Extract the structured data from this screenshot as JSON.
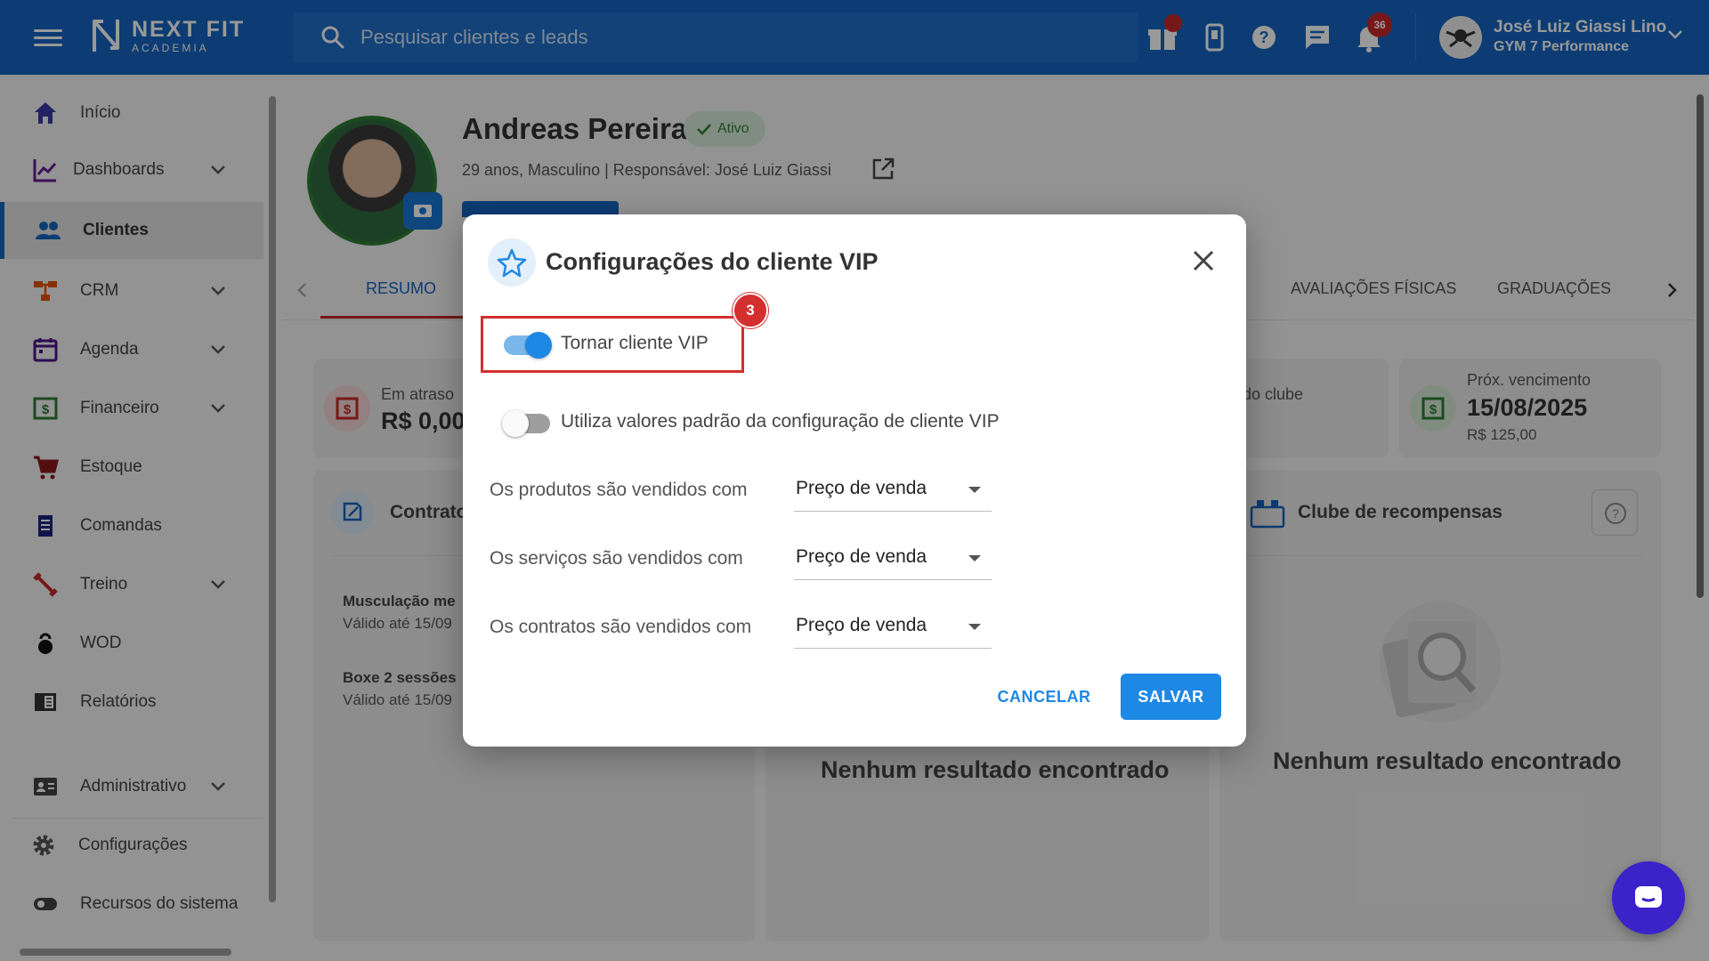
{
  "topbar": {
    "logo_line1": "NEXT FIT",
    "logo_line2": "ACADEMIA",
    "search_placeholder": "Pesquisar clientes e leads",
    "notifications_count": "36",
    "user_name": "José Luiz Giassi Lino",
    "user_org": "GYM 7 Performance"
  },
  "sidebar": {
    "items": [
      {
        "label": "Início",
        "icon": "home-icon"
      },
      {
        "label": "Dashboards",
        "icon": "chart-line-icon"
      },
      {
        "label": "Clientes",
        "icon": "people-icon"
      },
      {
        "label": "CRM",
        "icon": "flow-icon"
      },
      {
        "label": "Agenda",
        "icon": "calendar-icon"
      },
      {
        "label": "Financeiro",
        "icon": "money-icon"
      },
      {
        "label": "Estoque",
        "icon": "cart-icon"
      },
      {
        "label": "Comandas",
        "icon": "receipt-icon"
      },
      {
        "label": "Treino",
        "icon": "dumbbell-icon"
      },
      {
        "label": "WOD",
        "icon": "kettlebell-icon"
      },
      {
        "label": "Relatórios",
        "icon": "report-icon"
      },
      {
        "label": "Administrativo",
        "icon": "id-card-icon"
      },
      {
        "label": "Configurações",
        "icon": "gear-icon"
      },
      {
        "label": "Recursos do sistema",
        "icon": "toggle-icon"
      }
    ]
  },
  "profile": {
    "name": "Andreas Pereira",
    "status": "Ativo",
    "subtitle": "29 anos, Masculino | Responsável: José Luiz Giassi"
  },
  "tabs": [
    "RESUMO",
    "AVALIAÇÕES FÍSICAS",
    "GRADUAÇÕES"
  ],
  "cards": {
    "overdue_label": "Em atraso",
    "overdue_value": "R$ 0,00",
    "club_partial": "do clube",
    "next_due_label": "Próx. vencimento",
    "next_due_date": "15/08/2025",
    "next_due_amount": "R$ 125,00",
    "contracts_title": "Contrato",
    "contract1_name": "Musculação me",
    "contract1_valid": "Válido até 15/09",
    "contract2_name": "Boxe 2 sessões",
    "contract2_valid": "Válido até 15/09",
    "rewards_title": "Clube de recompensas",
    "empty_mid": "Nenhum resultado encontrado",
    "empty_right": "Nenhum resultado encontrado"
  },
  "modal": {
    "title": "Configurações do cliente VIP",
    "step_number": "3",
    "vip_toggle_label": "Tornar cliente VIP",
    "vip_toggle_on": true,
    "default_toggle_label": "Utiliza valores padrão da configuração de cliente VIP",
    "default_toggle_on": false,
    "rows": [
      {
        "label": "Os produtos são vendidos com",
        "value": "Preço de venda"
      },
      {
        "label": "Os serviços são vendidos com",
        "value": "Preço de venda"
      },
      {
        "label": "Os contratos são vendidos com",
        "value": "Preço de venda"
      }
    ],
    "cancel_label": "CANCELAR",
    "save_label": "SALVAR"
  },
  "colors": {
    "primary": "#1565c0",
    "accent": "#1e88e5",
    "highlight": "#d32f2f",
    "success": "#2e7d32"
  }
}
